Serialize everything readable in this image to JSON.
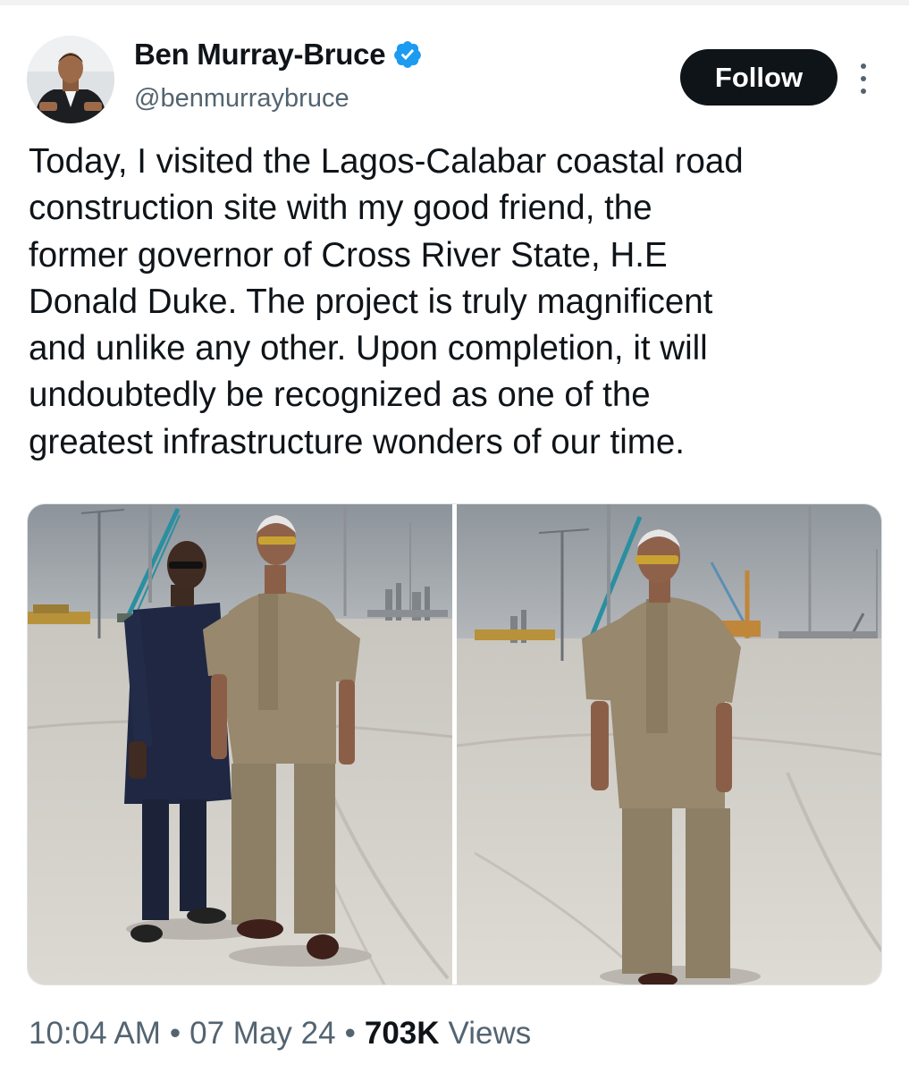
{
  "author": {
    "name": "Ben Murray-Bruce",
    "handle": "@benmurraybruce",
    "verified": true,
    "verified_color": "#1d9bf0"
  },
  "actions": {
    "follow_label": "Follow"
  },
  "icons": {
    "verified": "verified-badge-icon",
    "more": "more-options-icon"
  },
  "tweet": {
    "text": "Today, I visited the Lagos-Calabar coastal road\nconstruction site with my good friend, the\nformer governor of Cross River State, H.E\nDonald Duke. The project is truly magnificent\nand unlike any other. Upon completion, it will\nundoubtedly be recognized as one of the\ngreatest infrastructure wonders of our time."
  },
  "media": {
    "photos": [
      {
        "content": "two-men-standing-at-road-construction-site"
      },
      {
        "content": "man-standing-at-road-construction-site"
      }
    ]
  },
  "meta": {
    "time": "10:04 AM",
    "separator": "•",
    "date": "07 May 24",
    "views_count": "703K",
    "views_label": "Views"
  },
  "colors": {
    "text_primary": "#0f1419",
    "text_secondary": "#536471",
    "follow_bg": "#0f1419",
    "follow_text": "#ffffff"
  }
}
